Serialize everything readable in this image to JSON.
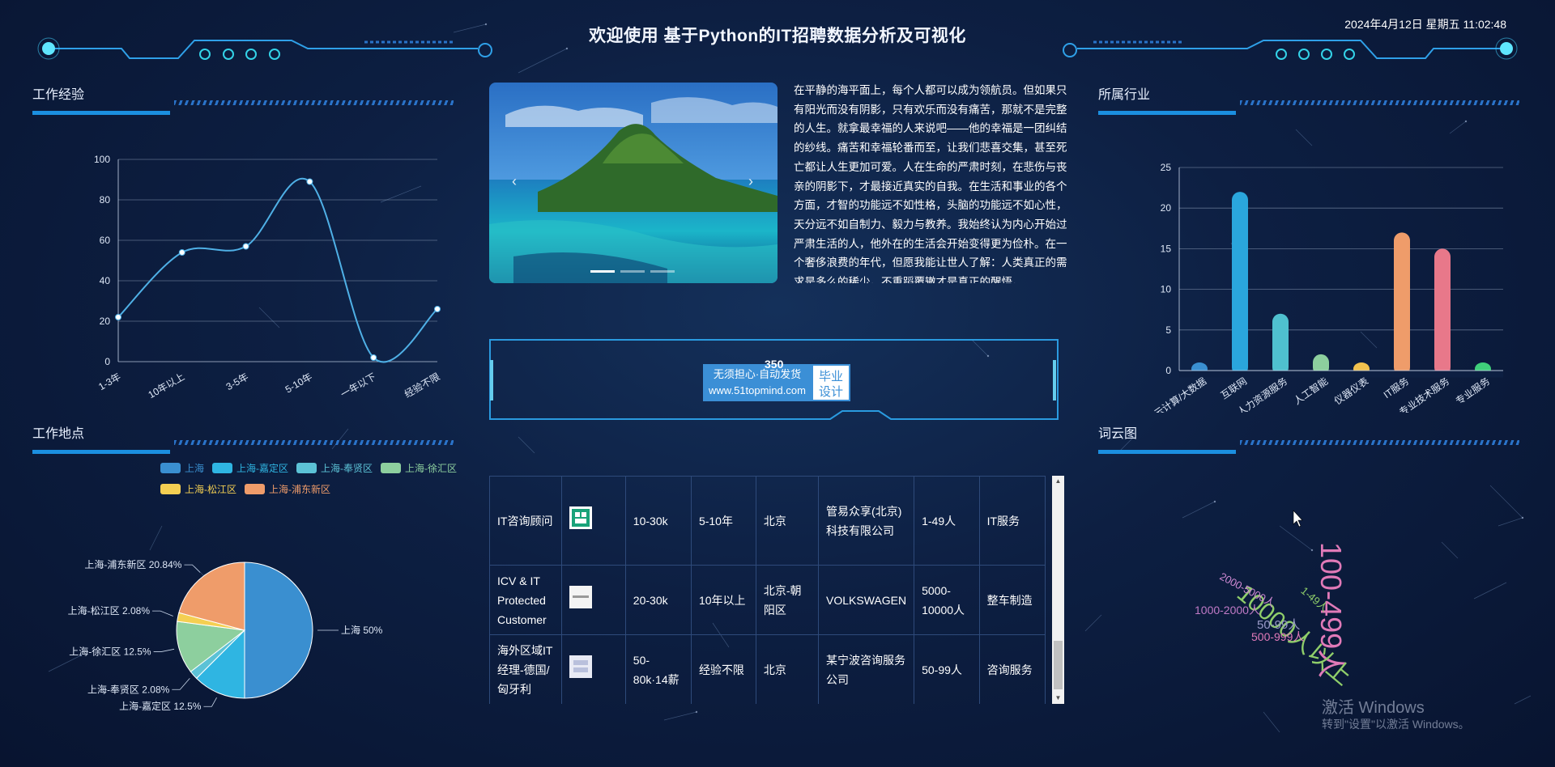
{
  "header": {
    "title": "欢迎使用 基于Python的IT招聘数据分析及可视化",
    "datetime": "2024年4月12日 星期五 11:02:48"
  },
  "panels": {
    "experience": "工作经验",
    "location": "工作地点",
    "industry": "所属行业",
    "wordcloud": "词云图"
  },
  "article": {
    "text": "在平静的海平面上，每个人都可以成为领航员。但如果只有阳光而没有阴影，只有欢乐而没有痛苦，那就不是完整的人生。就拿最幸福的人来说吧——他的幸福是一团纠结的纱线。痛苦和幸福轮番而至，让我们悲喜交集，甚至死亡都让人生更加可爱。人在生命的严肃时刻，在悲伤与丧亲的阴影下，才最接近真实的自我。在生活和事业的各个方面，才智的功能远不如性格，头脑的功能远不如心性，天分远不如自制力、毅力与教养。我始终认为内心开始过严肃生活的人，他外在的生活会开始变得更为俭朴。在一个奢侈浪费的年代，但愿我能让世人了解：人类真正的需求是多么的稀少。不重蹈覆辙才是真正的醒悟。"
  },
  "carousel": {
    "prev": "‹",
    "next": "›",
    "slides": 3,
    "active": 0
  },
  "badge": {
    "line1": "无须担心·自动发货",
    "line2": "www.51topmind.com",
    "right1": "毕业",
    "right2": "设计",
    "hidden_count": "350"
  },
  "colors": {
    "line": "#4fb0e6",
    "accent": "#1b8fe0",
    "pie": [
      "#3a8fd0",
      "#2fb5e2",
      "#5cc2d6",
      "#8dcf9e",
      "#f4cf52",
      "#ef9c6a"
    ]
  },
  "experience_chart": {
    "chart_data": {
      "type": "line",
      "categories": [
        "1-3年",
        "10年以上",
        "3-5年",
        "5-10年",
        "一年以下",
        "经验不限"
      ],
      "values": [
        22,
        54,
        57,
        89,
        2,
        26
      ],
      "ylim": [
        0,
        100
      ],
      "yticks": [
        "0",
        "20",
        "40",
        "60",
        "80",
        "100"
      ],
      "grid": true
    }
  },
  "location_chart": {
    "legend": [
      "上海",
      "上海-嘉定区",
      "上海-奉贤区",
      "上海-徐汇区",
      "上海-松江区",
      "上海-浦东新区"
    ],
    "labels": [
      "上海 50%",
      "上海-嘉定区 12.5%",
      "上海-奉贤区 2.08%",
      "上海-徐汇区 12.5%",
      "上海-松江区 2.08%",
      "上海-浦东新区 20.84%"
    ],
    "chart_data": {
      "type": "pie",
      "categories": [
        "上海",
        "上海-嘉定区",
        "上海-奉贤区",
        "上海-徐汇区",
        "上海-松江区",
        "上海-浦东新区"
      ],
      "values": [
        50,
        12.5,
        2.08,
        12.5,
        2.08,
        20.84
      ],
      "legend": "top"
    }
  },
  "industry_chart": {
    "chart_data": {
      "type": "bar",
      "categories": [
        "云计算/大数据",
        "互联网",
        "人力资源服务",
        "人工智能",
        "仪器仪表",
        "IT服务",
        "专业技术服务",
        "专业服务"
      ],
      "values": [
        1,
        22,
        7,
        2,
        1,
        17,
        15,
        1
      ],
      "ylim": [
        0,
        25
      ],
      "yticks": [
        "0",
        "5",
        "10",
        "15",
        "20",
        "25"
      ],
      "colors": [
        "#3a8fd0",
        "#2aa6dc",
        "#4fc0cf",
        "#8dcf9e",
        "#f2c14e",
        "#ef9c6a",
        "#e8788a",
        "#3fcf7a"
      ],
      "grid": true
    }
  },
  "wordcloud": {
    "words": [
      "100-499人",
      "10000人以上",
      "1-49人",
      "2000-5000人",
      "1000-2000人",
      "50-99人",
      "500-999人"
    ],
    "colors": [
      "#e07ab8",
      "#8fce6a",
      "#8fce6a",
      "#d08ad4",
      "#c07ac6",
      "#9a9ac8",
      "#e07ab8"
    ]
  },
  "table": {
    "rows": [
      [
        "IT咨询顾问",
        "",
        "10-30k",
        "5-10年",
        "北京",
        "管易众享(北京)科技有限公司",
        "1-49人",
        "IT服务"
      ],
      [
        "ICV & IT Protected Customer",
        "",
        "20-30k",
        "10年以上",
        "北京-朝阳区",
        "VOLKSWAGEN",
        "5000-10000人",
        "整车制造"
      ],
      [
        "海外区域IT经理-德国/匈牙利",
        "",
        "50-80k·14薪",
        "经验不限",
        "北京",
        "某宁波咨询服务公司",
        "50-99人",
        "咨询服务"
      ]
    ]
  },
  "watermark": {
    "line1": "激活 Windows",
    "line2": "转到\"设置\"以激活 Windows。"
  }
}
